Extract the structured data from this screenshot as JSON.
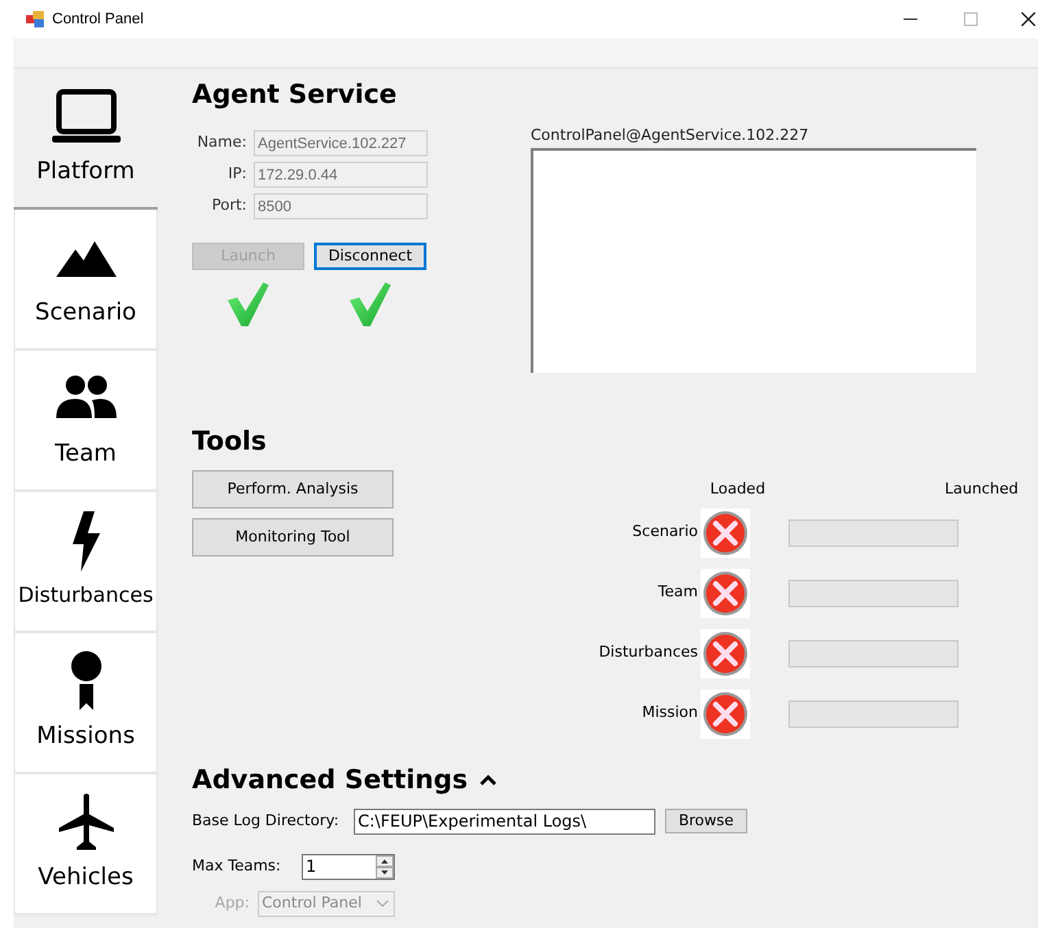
{
  "window": {
    "title": "Control Panel"
  },
  "sidebar": {
    "items": [
      {
        "label": "Platform",
        "kind": "laptop",
        "selected": true
      },
      {
        "label": "Scenario",
        "kind": "mountain",
        "selected": false
      },
      {
        "label": "Team",
        "kind": "people",
        "selected": false
      },
      {
        "label": "Disturbances",
        "kind": "bolt",
        "selected": false
      },
      {
        "label": "Missions",
        "kind": "medal",
        "selected": false
      },
      {
        "label": "Vehicles",
        "kind": "plane",
        "selected": false
      }
    ]
  },
  "agent_service": {
    "title": "Agent Service",
    "fields": [
      {
        "label": "Name:",
        "value": "AgentService.102.227",
        "disabled": true
      },
      {
        "label": "IP:",
        "value": "172.29.0.44",
        "disabled": true
      },
      {
        "label": "Port:",
        "value": "8500",
        "disabled": true
      }
    ],
    "buttons": [
      {
        "label": "Launch",
        "disabled": true,
        "focused": false,
        "ok": true
      },
      {
        "label": "Disconnect",
        "disabled": false,
        "focused": true,
        "ok": true
      }
    ],
    "log": {
      "label": "ControlPanel@AgentService.102.227"
    }
  },
  "tools": {
    "title": "Tools",
    "buttons": [
      "Perform. Analysis",
      "Monitoring Tool"
    ],
    "columns": [
      "Loaded",
      "Launched"
    ],
    "rows": [
      {
        "label": "Scenario",
        "loaded": false
      },
      {
        "label": "Team",
        "loaded": false
      },
      {
        "label": "Disturbances",
        "loaded": false
      },
      {
        "label": "Mission",
        "loaded": false
      }
    ]
  },
  "advanced": {
    "title": "Advanced Settings",
    "expanded": true,
    "log_dir": {
      "label": "Base Log Directory:",
      "value": "C:\\FEUP\\Experimental Logs\\",
      "button": "Browse"
    },
    "max_teams": {
      "label": "Max Teams:",
      "value": "1"
    },
    "app": {
      "label": "App:",
      "value": "Control Panel",
      "disabled": true
    }
  }
}
